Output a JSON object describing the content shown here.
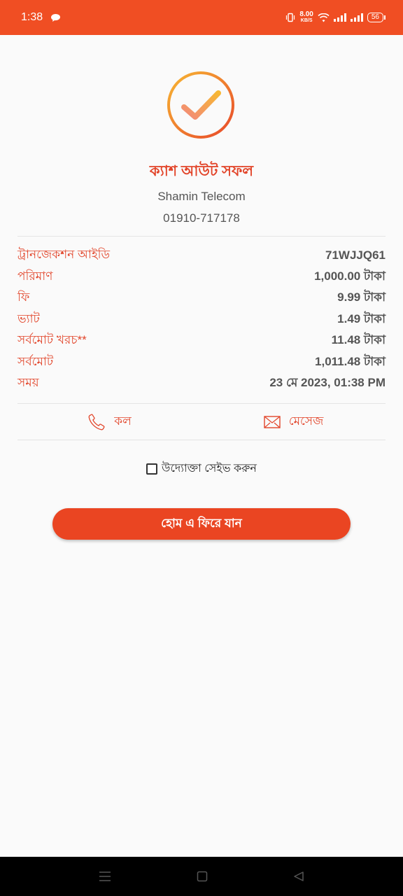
{
  "status_bar": {
    "time": "1:38",
    "net_speed": "8.00",
    "net_unit": "KB/S",
    "battery": "56"
  },
  "result": {
    "title": "ক্যাশ আউট সফল",
    "merchant_name": "Shamin Telecom",
    "merchant_number": "01910-717178"
  },
  "details": [
    {
      "label": "ট্রানজেকশন আইডি",
      "value": "71WJJQ61"
    },
    {
      "label": "পরিমাণ",
      "value": "1,000.00 টাকা"
    },
    {
      "label": "ফি",
      "value": "9.99 টাকা"
    },
    {
      "label": "ভ্যাট",
      "value": "1.49 টাকা"
    },
    {
      "label": "সর্বমোট খরচ**",
      "value": "11.48 টাকা"
    },
    {
      "label": "সর্বমোট",
      "value": "1,011.48 টাকা"
    },
    {
      "label": "সময়",
      "value": "23 মে 2023, 01:38 PM"
    }
  ],
  "actions": {
    "call_label": "কল",
    "message_label": "মেসেজ"
  },
  "save_entrepreneur_label": "উদ্যোক্তা সেইভ করুন",
  "home_button_label": "হোম এ ফিরে যান",
  "colors": {
    "accent": "#f04e23",
    "label_red": "#e2452a",
    "value_gray": "#555555"
  }
}
